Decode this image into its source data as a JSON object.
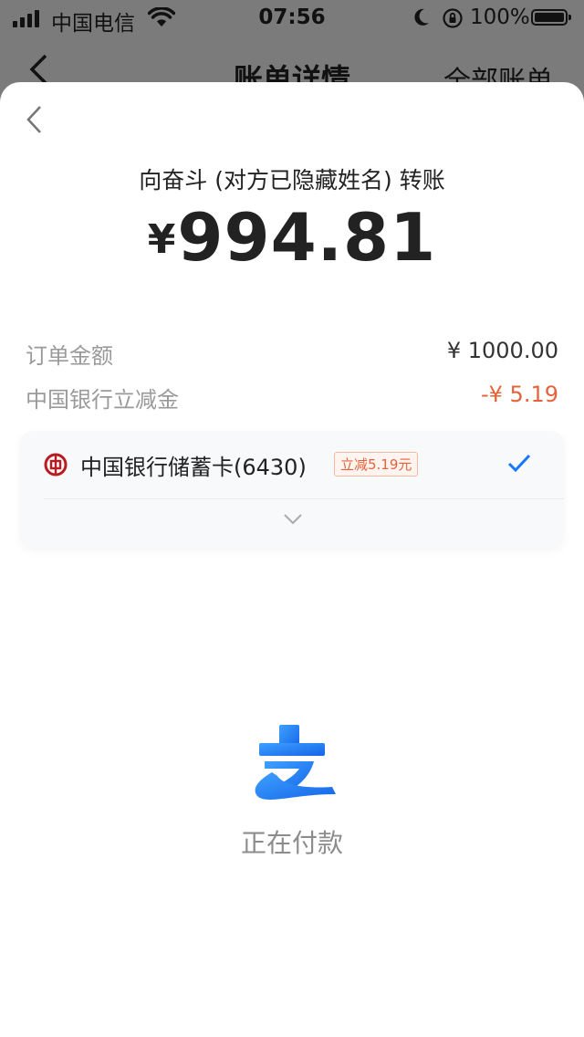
{
  "status_bar": {
    "carrier": "中国电信",
    "time": "07:56",
    "battery": "100%"
  },
  "background_nav": {
    "title": "账单详情",
    "right_link": "全部账单"
  },
  "payment": {
    "payee": "向奋斗 (对方已隐藏姓名) 转账",
    "currency_symbol": "¥",
    "amount": "994.81",
    "details": [
      {
        "label": "订单金额",
        "value": "¥ 1000.00"
      },
      {
        "label": "中国银行立减金",
        "value": "-¥ 5.19"
      }
    ],
    "method": {
      "name": "中国银行储蓄卡(6430)",
      "promo": "立减5.19元"
    },
    "status_text": "正在付款"
  },
  "colors": {
    "accent_blue": "#1677ff",
    "discount_orange": "#e5633a",
    "bank_red": "#b81c22"
  },
  "icons": {
    "back": "chevron-left-icon",
    "selected": "checkmark-icon",
    "expand": "chevron-down-icon",
    "bank": "bank-of-china-icon",
    "brand": "alipay-logo-icon"
  }
}
